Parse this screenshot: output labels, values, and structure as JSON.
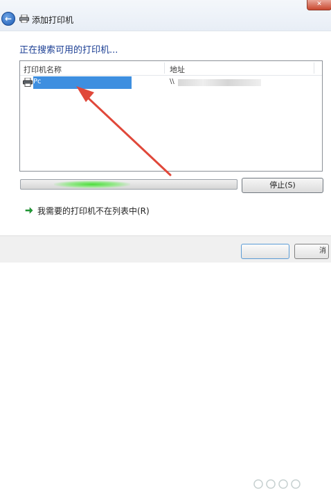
{
  "window": {
    "title": "添加打印机",
    "back_icon": "back-arrow-icon",
    "close_icon": "close-icon"
  },
  "heading": "正在搜索可用的打印机...",
  "printer_list": {
    "columns": [
      "打印机名称",
      "地址"
    ],
    "rows": [
      {
        "name": "Pc",
        "address": "\\\\",
        "selected": true,
        "icon": "printer-icon"
      }
    ]
  },
  "progress": {
    "state": "searching (indeterminate)",
    "accent_color": "#3fd13a"
  },
  "buttons": {
    "stop": "停止(S)",
    "cancel_fragment": "消"
  },
  "link": {
    "text": "我需要的打印机不在列表中(R)",
    "icon": "green-arrow-icon"
  },
  "colors": {
    "heading": "#1c3f94",
    "selection": "#3e8fe0",
    "annotation_arrow": "#e0483a"
  }
}
